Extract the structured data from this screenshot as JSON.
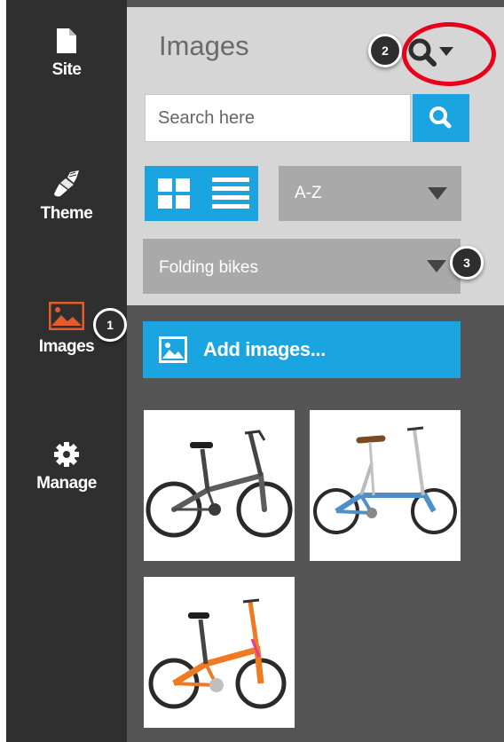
{
  "sidebar": {
    "items": [
      {
        "label": "Site",
        "icon": "document-icon"
      },
      {
        "label": "Theme",
        "icon": "paintbrush-icon"
      },
      {
        "label": "Images",
        "icon": "image-icon",
        "active": true
      },
      {
        "label": "Manage",
        "icon": "gear-icon"
      }
    ]
  },
  "panel": {
    "title": "Images",
    "search": {
      "placeholder": "Search here"
    },
    "sort": {
      "selected": "A-Z"
    },
    "category": {
      "selected": "Folding bikes"
    },
    "add_button_label": "Add images...",
    "images": [
      {
        "name": "dark-grey-folding-bike"
      },
      {
        "name": "blue-folding-bike"
      },
      {
        "name": "orange-folding-bike"
      }
    ]
  },
  "callouts": [
    "1",
    "2",
    "3"
  ],
  "colors": {
    "sidebar_bg": "#2f2f2f",
    "panel_bg": "#555555",
    "top_bg": "#d6d6d6",
    "accent": "#1ba5e0",
    "active_icon": "#e35d2a",
    "highlight_ring": "#e8001a"
  }
}
